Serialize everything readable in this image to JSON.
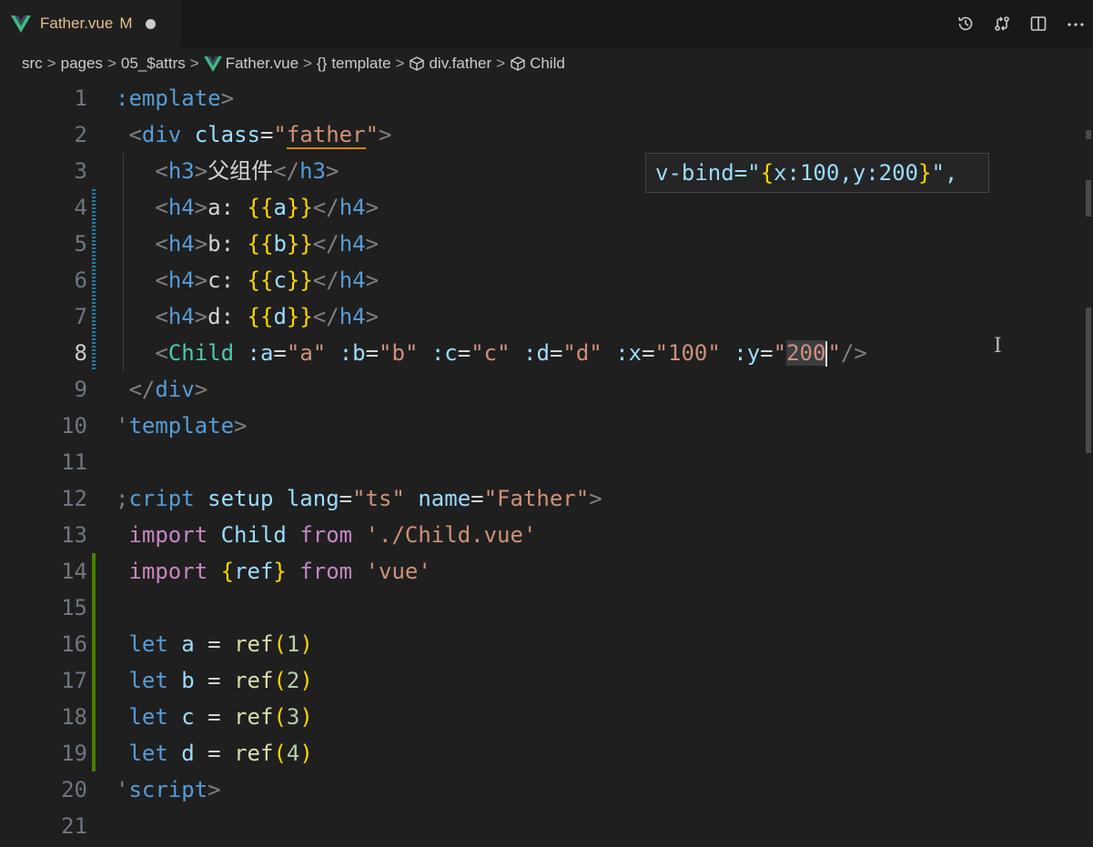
{
  "tab": {
    "filename": "Father.vue",
    "status": "M"
  },
  "breadcrumb": {
    "src": "src",
    "pages": "pages",
    "folder": "05_$attrs",
    "file": "Father.vue",
    "template": "template",
    "div": "div.father",
    "child": "Child"
  },
  "hover_text": {
    "prefix": "v-bind=\"",
    "brace_open": "{",
    "body": "x:100,y:200",
    "brace_close": "}",
    "suffix": "\","
  },
  "code": {
    "l1": ":emplate",
    "l2_tag": "div",
    "l2_attr": "class",
    "l2_val": "father",
    "l3_text": "父组件",
    "l4": "a:",
    "l5": "b:",
    "l6": "c:",
    "l7": "d:",
    "l4v": "a",
    "l5v": "b",
    "l6v": "c",
    "l7v": "d",
    "l8_comp": "Child",
    "l8_a": ":a",
    "l8_av": "\"a\"",
    "l8_b": ":b",
    "l8_bv": "\"b\"",
    "l8_c": ":c",
    "l8_cv": "\"c\"",
    "l8_d": ":d",
    "l8_dv": "\"d\"",
    "l8_x": ":x",
    "l8_xv": "\"100\"",
    "l8_y": ":y",
    "l8_yq": "\"",
    "l8_yv": "200",
    "l8_yq2": "\"",
    "l9": "div",
    "l10": "template",
    "l12_kw": "cript",
    "l12_setup": "setup",
    "l12_lang": "lang",
    "l12_langv": "\"ts\"",
    "l12_name": "name",
    "l12_namev": "\"Father\"",
    "l13_import": "import",
    "l13_id": "Child",
    "l13_from": "from",
    "l13_path": "'./Child.vue'",
    "l14_import": "import",
    "l14_id": "ref",
    "l14_from": "from",
    "l14_path": "'vue'",
    "let": "let",
    "l16_var": "a",
    "l16_n": "1",
    "l17_var": "b",
    "l17_n": "2",
    "l18_var": "c",
    "l18_n": "3",
    "l19_var": "d",
    "l19_n": "4",
    "ref": "ref",
    "l20": "script"
  },
  "line_numbers": [
    "1",
    "2",
    "3",
    "4",
    "5",
    "6",
    "7",
    "8",
    "9",
    "10",
    "11",
    "12",
    "13",
    "14",
    "15",
    "16",
    "17",
    "18",
    "19",
    "20",
    "21"
  ],
  "colors": {
    "background": "#1f1f1f",
    "tag": "#569cd6",
    "attribute": "#9cdcfe",
    "string": "#ce9178",
    "bracket": "#ffd700",
    "component": "#4ec9b0",
    "keyword_import": "#c586c0",
    "function": "#dcdcaa",
    "number": "#b5cea8",
    "modified_tab": "#e2c08d",
    "gutter_added": "#487e02",
    "gutter_modified": "#1b81a8"
  },
  "icons": [
    "vue-logo-icon",
    "timeline-icon",
    "source-compare-icon",
    "split-editor-icon",
    "more-actions-icon",
    "symbol-brackets-icon",
    "cube-icon"
  ]
}
